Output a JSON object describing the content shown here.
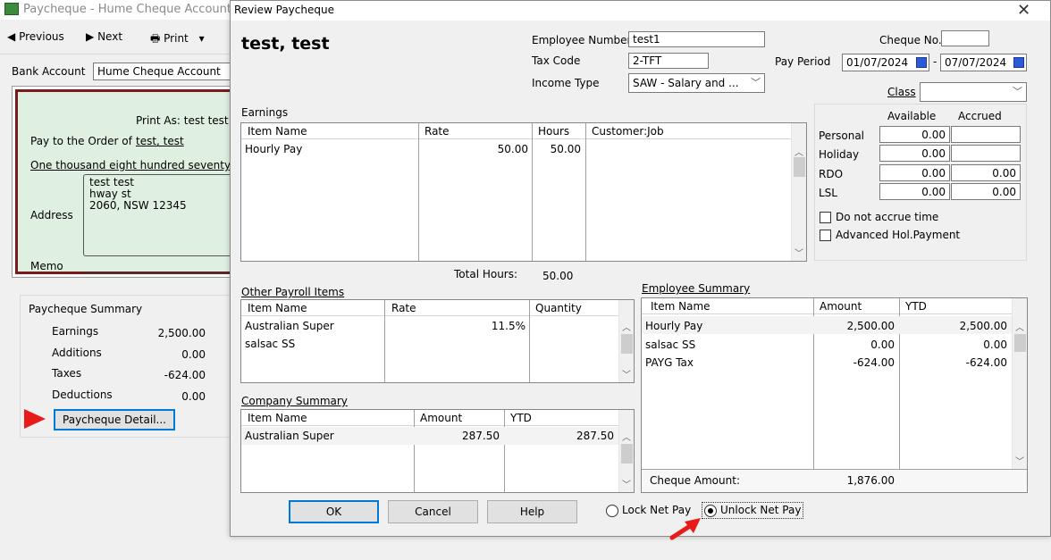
{
  "bg": {
    "title": "Paycheque - Hume Cheque Account",
    "toolbar": {
      "previous": "Previous",
      "next": "Next",
      "print": "Print"
    },
    "bank_label": "Bank Account",
    "bank_value": "Hume Cheque Account",
    "print_as": "Print As:  test test",
    "pay_to_label": "Pay to the Order of",
    "pay_to_value": "test, test",
    "amount_words": "One thousand eight hundred seventy-s",
    "address_label": "Address",
    "address_lines": [
      "test test",
      "hway st",
      "2060, NSW 12345"
    ],
    "memo_label": "Memo",
    "summary": {
      "title": "Paycheque Summary",
      "rows": [
        {
          "label": "Earnings",
          "value": "2,500.00"
        },
        {
          "label": "Additions",
          "value": "0.00"
        },
        {
          "label": "Taxes",
          "value": "-624.00"
        },
        {
          "label": "Deductions",
          "value": "0.00"
        }
      ],
      "detail_button": "Paycheque Detail..."
    }
  },
  "dialog": {
    "title": "Review Paycheque",
    "employee_name": "test, test",
    "employee_number_label": "Employee Number",
    "employee_number": "test1",
    "tax_code_label": "Tax Code",
    "tax_code": "2-TFT",
    "income_type_label": "Income Type",
    "income_type": "SAW - Salary and ...",
    "cheque_no_label": "Cheque No.",
    "cheque_no": "",
    "pay_period_label": "Pay Period",
    "pay_period_from": "01/07/2024",
    "pay_period_to": "07/07/2024",
    "class_label": "Class",
    "class_value": "",
    "earnings": {
      "label": "Earnings",
      "headers": [
        "Item Name",
        "Rate",
        "Hours",
        "Customer:Job"
      ],
      "rows": [
        {
          "item": "Hourly Pay",
          "rate": "50.00",
          "hours": "50.00",
          "job": ""
        }
      ],
      "total_hours_label": "Total Hours:",
      "total_hours": "50.00"
    },
    "leave": {
      "headers": [
        "Available",
        "Accrued"
      ],
      "rows": [
        {
          "label": "Personal",
          "available": "0.00",
          "accrued": ""
        },
        {
          "label": "Holiday",
          "available": "0.00",
          "accrued": ""
        },
        {
          "label": "RDO",
          "available": "0.00",
          "accrued": "0.00"
        },
        {
          "label": "LSL",
          "available": "0.00",
          "accrued": "0.00"
        }
      ],
      "do_not_accrue": "Do not accrue time",
      "advanced_hol": "Advanced Hol.Payment"
    },
    "other_items": {
      "label": "Other Payroll Items",
      "headers": [
        "Item Name",
        "Rate",
        "Quantity"
      ],
      "rows": [
        {
          "item": "Australian Super",
          "rate": "11.5%",
          "qty": ""
        },
        {
          "item": "salsac SS",
          "rate": "",
          "qty": ""
        }
      ]
    },
    "employee_summary": {
      "label": "Employee Summary",
      "headers": [
        "Item Name",
        "Amount",
        "YTD"
      ],
      "rows": [
        {
          "item": "Hourly Pay",
          "amount": "2,500.00",
          "ytd": "2,500.00"
        },
        {
          "item": "salsac SS",
          "amount": "0.00",
          "ytd": "0.00"
        },
        {
          "item": "PAYG Tax",
          "amount": "-624.00",
          "ytd": "-624.00"
        }
      ],
      "cheque_amount_label": "Cheque Amount:",
      "cheque_amount": "1,876.00"
    },
    "company_summary": {
      "label": "Company Summary",
      "headers": [
        "Item Name",
        "Amount",
        "YTD"
      ],
      "rows": [
        {
          "item": "Australian Super",
          "amount": "287.50",
          "ytd": "287.50"
        }
      ]
    },
    "buttons": {
      "ok": "OK",
      "cancel": "Cancel",
      "help": "Help"
    },
    "lock_net_pay": "Lock Net Pay",
    "unlock_net_pay": "Unlock Net Pay",
    "selected_mode": "unlock"
  },
  "colors": {
    "dialog_bg": "#f0f0f0",
    "cheque_bg": "#dff0e0",
    "cheque_border": "#7b1a1a",
    "annotation_red": "#e81a1a",
    "selected_row": "#cce8ff"
  }
}
